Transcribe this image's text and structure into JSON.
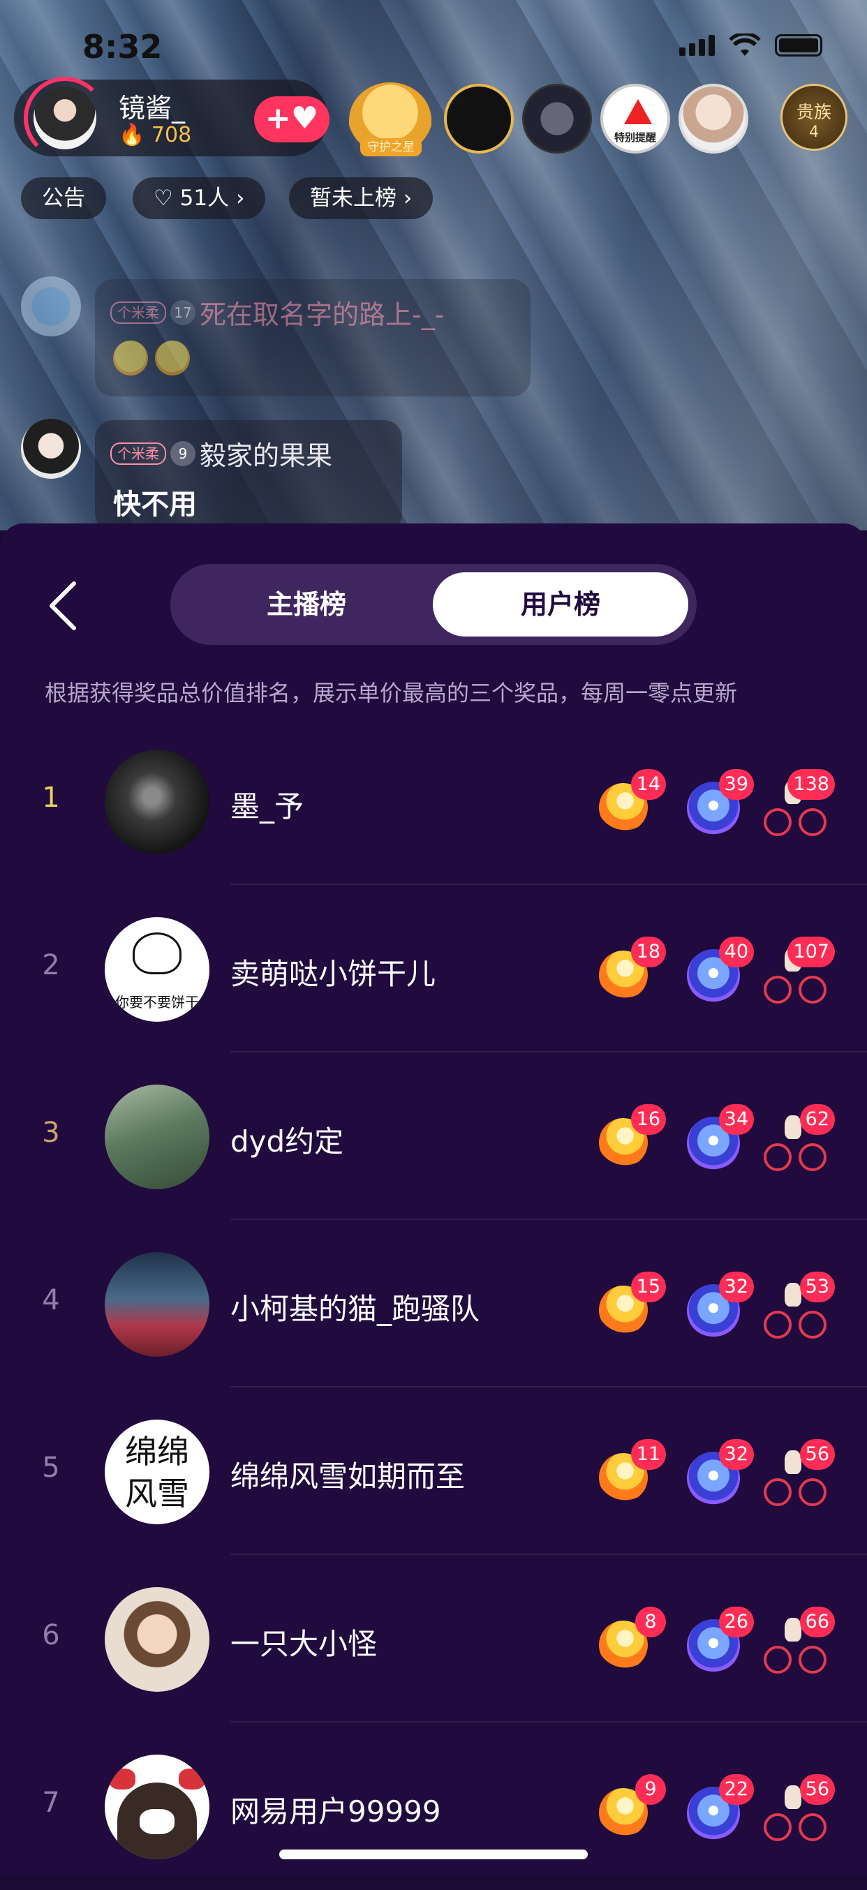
{
  "status_bar": {
    "time": "8:32"
  },
  "host": {
    "name": "镜酱_",
    "heat": "708",
    "follow_icon": "plus-heart-icon"
  },
  "top_bar": {
    "guard_label": "守护之星",
    "warning_label": "特别提醒",
    "noble_label": "贵族",
    "noble_count": "4"
  },
  "chips": {
    "notice": "公告",
    "viewers": "51人",
    "rank": "暂未上榜"
  },
  "chat": [
    {
      "fan_badge": "个米柔",
      "level": "17",
      "name": "死在取名字的路上-_-",
      "content_emojis": [
        "rofl-emoji",
        "rofl-emoji"
      ]
    },
    {
      "fan_badge": "个米柔",
      "level": "9",
      "name": "毅家的果果",
      "message": "快不用"
    }
  ],
  "panel": {
    "tabs": [
      {
        "label": "主播榜",
        "active": false
      },
      {
        "label": "用户榜",
        "active": true
      }
    ],
    "note": "根据获得奖品总价值排名，展示单价最高的三个奖品，每周一零点更新",
    "rows": [
      {
        "rank": "1",
        "name": "墨_予",
        "gifts": [
          "14",
          "39",
          "138"
        ]
      },
      {
        "rank": "2",
        "name": "卖萌哒小饼干儿",
        "gifts": [
          "18",
          "40",
          "107"
        ]
      },
      {
        "rank": "3",
        "name": "dyd约定",
        "gifts": [
          "16",
          "34",
          "62"
        ]
      },
      {
        "rank": "4",
        "name": "小柯基的猫_跑骚队",
        "gifts": [
          "15",
          "32",
          "53"
        ]
      },
      {
        "rank": "5",
        "name": "绵绵风雪如期而至",
        "gifts": [
          "11",
          "32",
          "56"
        ]
      },
      {
        "rank": "6",
        "name": "一只大小怪",
        "gifts": [
          "8",
          "26",
          "66"
        ]
      },
      {
        "rank": "7",
        "name": "网易用户99999",
        "gifts": [
          "9",
          "22",
          "56"
        ]
      }
    ],
    "gift_icons": [
      "rocket-icon",
      "gem-icon",
      "bike-icon"
    ],
    "avatar_texts": {
      "row2": "你要不要饼干",
      "row5": "绵绵风雪"
    }
  },
  "colors": {
    "panel_bg": "#200a3e",
    "accent": "#ff2d55",
    "gold": "#e9cf5a"
  }
}
